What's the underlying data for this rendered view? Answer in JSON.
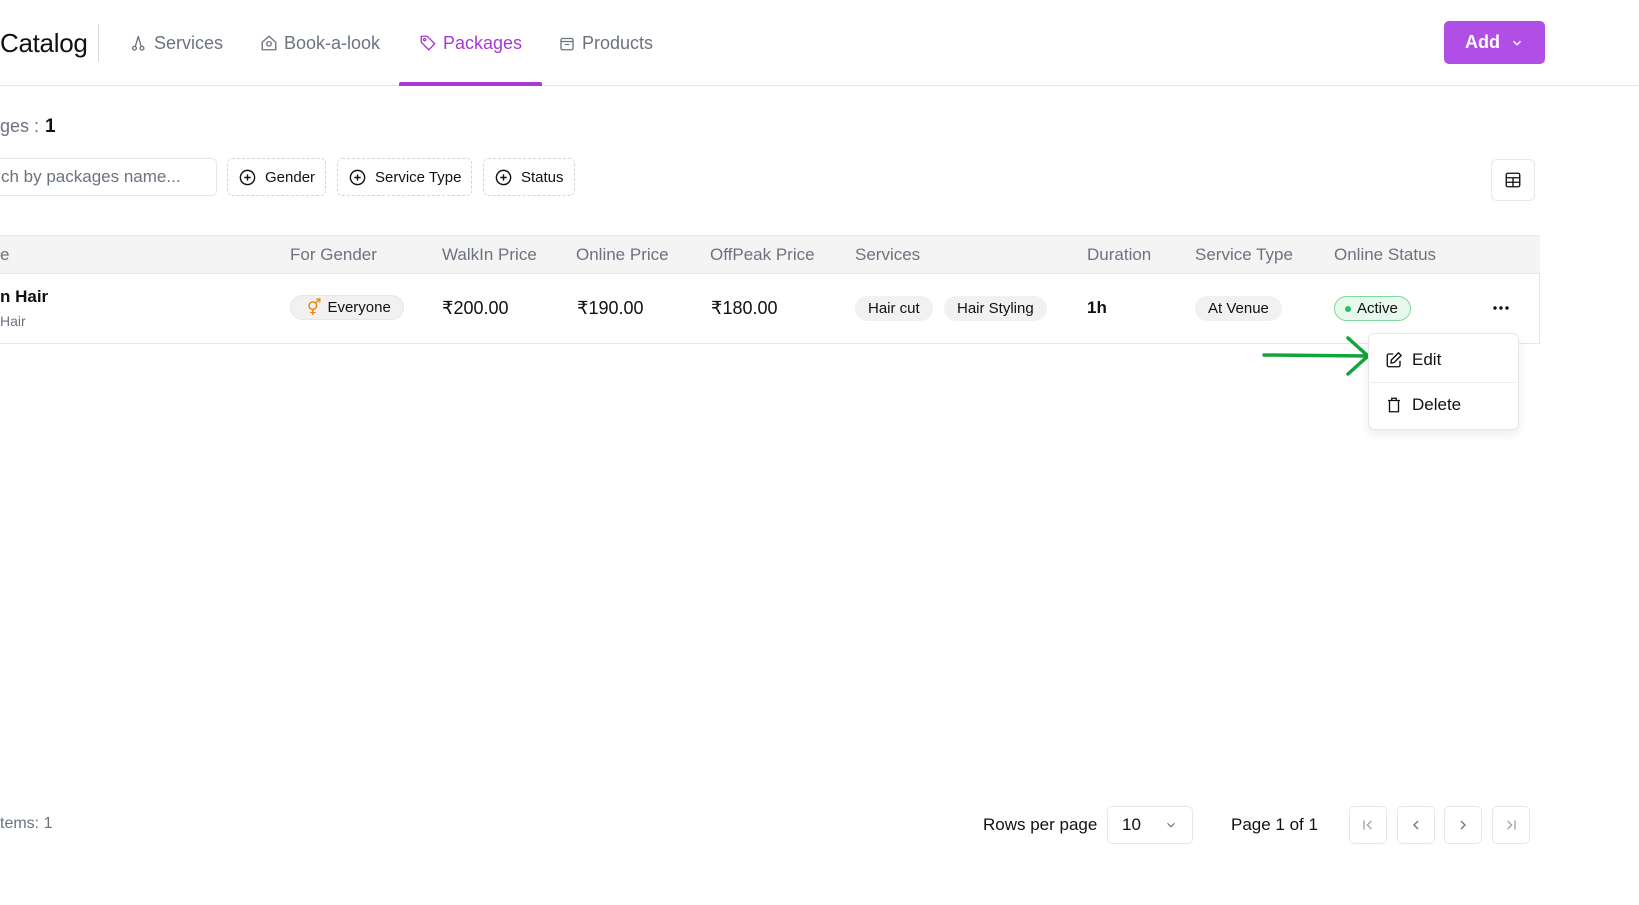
{
  "header": {
    "title": "Catalog",
    "tabs": [
      {
        "label": "Services",
        "icon": "scissors-icon"
      },
      {
        "label": "Book-a-look",
        "icon": "house-icon"
      },
      {
        "label": "Packages",
        "icon": "tag-icon",
        "active": true
      },
      {
        "label": "Products",
        "icon": "bag-icon"
      }
    ],
    "add_label": "Add"
  },
  "summary": {
    "label": "ges :",
    "value": "1"
  },
  "filters": {
    "search_placeholder": "ch by packages name...",
    "chips": [
      "Gender",
      "Service Type",
      "Status"
    ]
  },
  "table": {
    "columns": [
      "e",
      "For Gender",
      "WalkIn Price",
      "Online Price",
      "OffPeak Price",
      "Services",
      "Duration",
      "Service Type",
      "Online Status"
    ],
    "rows": [
      {
        "name": "n Hair",
        "subtitle": "Hair",
        "gender": "Everyone",
        "walkin_price": "₹200.00",
        "online_price": "₹190.00",
        "offpeak_price": "₹180.00",
        "services": [
          "Hair cut",
          "Hair Styling"
        ],
        "duration": "1h",
        "service_type": "At Venue",
        "status": "Active"
      }
    ]
  },
  "row_menu": {
    "edit": "Edit",
    "delete": "Delete"
  },
  "footer": {
    "total": "tems: 1",
    "rows_per_page_label": "Rows per page",
    "rows_per_page_value": "10",
    "page_indicator": "Page 1 of 1"
  },
  "colors": {
    "accent": "#b14ee5",
    "active_status": "#22c55e",
    "annotation_arrow": "#12a53a"
  }
}
